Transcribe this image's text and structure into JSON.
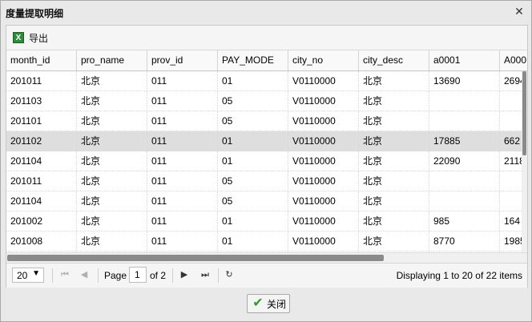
{
  "window": {
    "title": "度量提取明细"
  },
  "toolbar": {
    "export_label": "导出"
  },
  "grid": {
    "columns": [
      "month_id",
      "pro_name",
      "prov_id",
      "PAY_MODE",
      "city_no",
      "city_desc",
      "a0001",
      "A000"
    ],
    "rows": [
      [
        "201011",
        "北京",
        "011",
        "01",
        "V0110000",
        "北京",
        "13690",
        "2694"
      ],
      [
        "201103",
        "北京",
        "011",
        "05",
        "V0110000",
        "北京",
        "",
        ""
      ],
      [
        "201101",
        "北京",
        "011",
        "05",
        "V0110000",
        "北京",
        "",
        ""
      ],
      [
        "201102",
        "北京",
        "011",
        "01",
        "V0110000",
        "北京",
        "17885",
        "662"
      ],
      [
        "201104",
        "北京",
        "011",
        "01",
        "V0110000",
        "北京",
        "22090",
        "2118"
      ],
      [
        "201011",
        "北京",
        "011",
        "05",
        "V0110000",
        "北京",
        "",
        ""
      ],
      [
        "201104",
        "北京",
        "011",
        "05",
        "V0110000",
        "北京",
        "",
        ""
      ],
      [
        "201002",
        "北京",
        "011",
        "01",
        "V0110000",
        "北京",
        "985",
        "164"
      ],
      [
        "201008",
        "北京",
        "011",
        "01",
        "V0110000",
        "北京",
        "8770",
        "1985"
      ],
      [
        "",
        "",
        "",
        "",
        "",
        "",
        "",
        ""
      ]
    ],
    "selected_row": 3
  },
  "pager": {
    "page_size": "20",
    "page_label": "Page",
    "current_page": "1",
    "of_label": "of 2",
    "display_text": "Displaying 1 to 20 of 22 items"
  },
  "footer": {
    "close_label": "关闭"
  },
  "icons": {
    "close": "close-icon",
    "export": "excel-icon",
    "first": "first-page-icon",
    "prev": "prev-page-icon",
    "next": "next-page-icon",
    "last": "last-page-icon",
    "refresh": "refresh-icon",
    "confirm": "check-icon"
  }
}
